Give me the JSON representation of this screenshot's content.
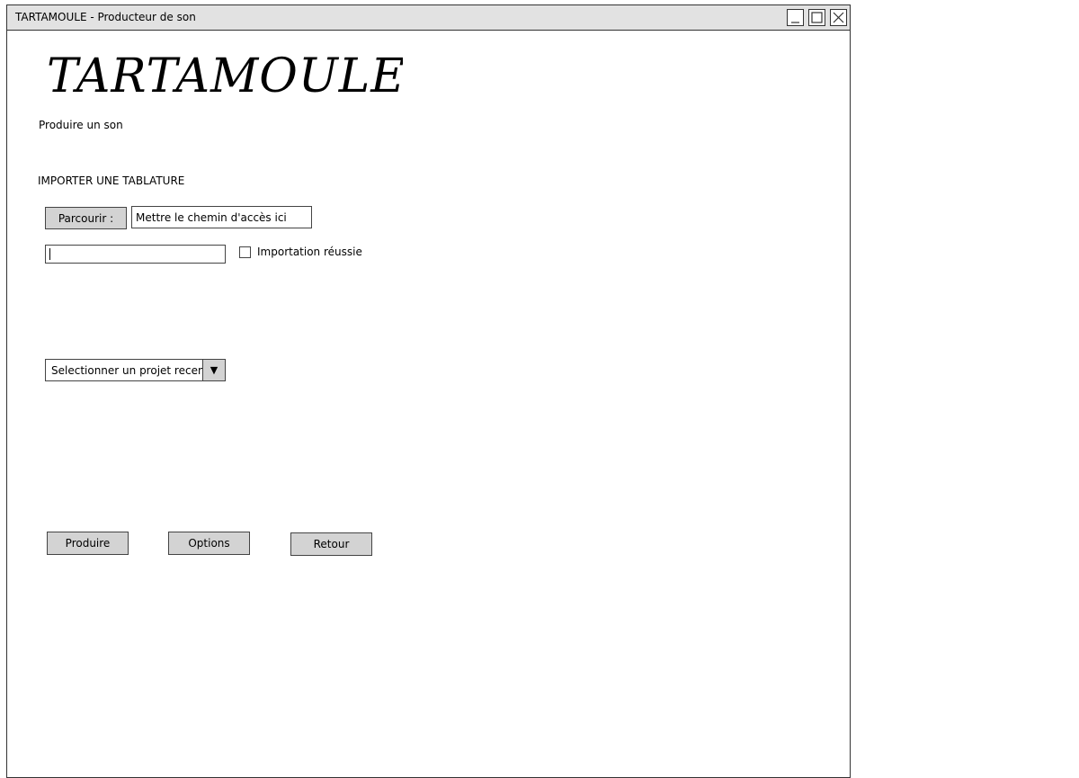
{
  "window": {
    "title": "TARTAMOULE - Producteur de son",
    "controls": {
      "minimize_icon": "minimize-icon",
      "maximize_icon": "maximize-icon",
      "close_icon": "close-icon"
    }
  },
  "logo": {
    "text": "TARTAMOULE"
  },
  "subtitle": "Produire un son",
  "import": {
    "heading": "IMPORTER UNE TABLATURE",
    "browse_label": "Parcourir :",
    "path_value": "Mettre le chemin d'accès ici",
    "progress_value": "",
    "success_label": "Importation réussie",
    "success_checked": false
  },
  "recent": {
    "selected": "Selectionner un projet recent",
    "arrow_icon": "triangle-down-icon"
  },
  "actions": {
    "produce_label": "Produire",
    "options_label": "Options",
    "back_label": "Retour"
  },
  "colors": {
    "titlebar": "#e2e2e2",
    "button": "#d3d3d3",
    "border": "#333333"
  }
}
